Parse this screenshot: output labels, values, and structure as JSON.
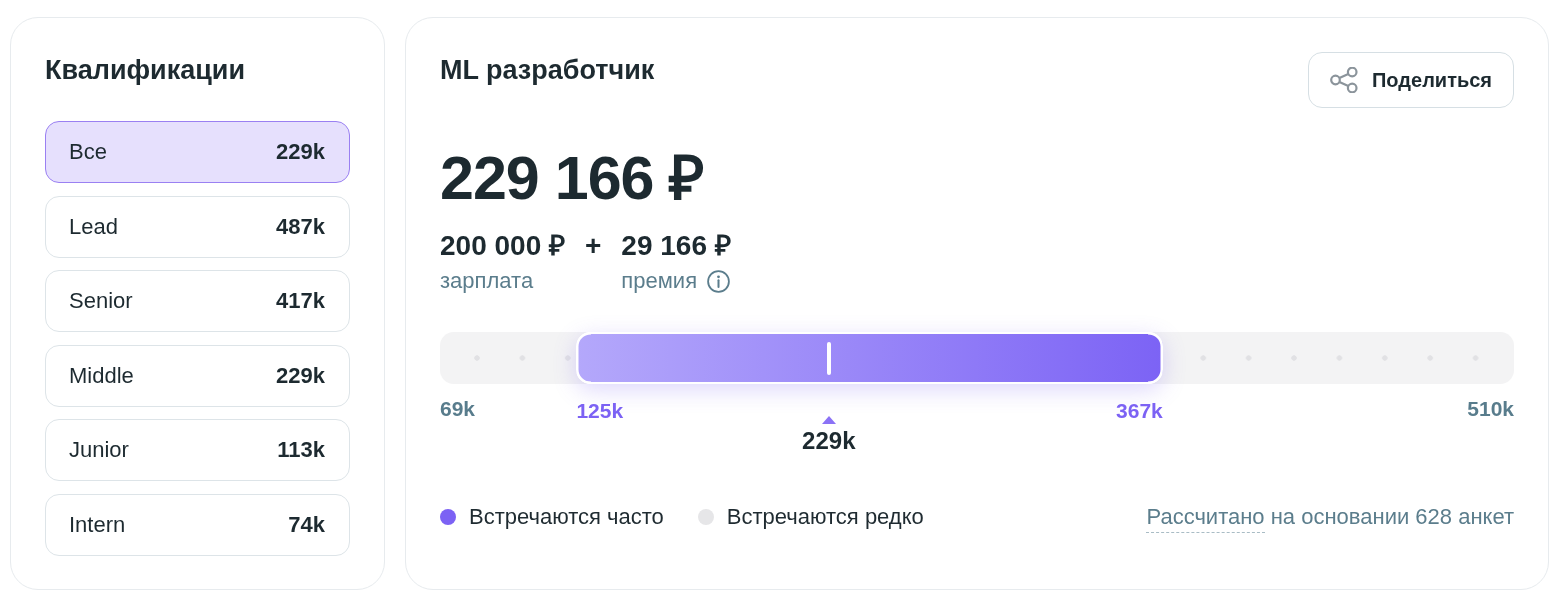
{
  "qualifications": {
    "title": "Квалификации",
    "items": [
      {
        "label": "Все",
        "value": "229k",
        "selected": true
      },
      {
        "label": "Lead",
        "value": "487k",
        "selected": false
      },
      {
        "label": "Senior",
        "value": "417k",
        "selected": false
      },
      {
        "label": "Middle",
        "value": "229k",
        "selected": false
      },
      {
        "label": "Junior",
        "value": "113k",
        "selected": false
      },
      {
        "label": "Intern",
        "value": "74k",
        "selected": false
      }
    ]
  },
  "salary": {
    "title": "ML разработчик",
    "share_button": "Поделиться",
    "total": "229 166 ₽",
    "base": {
      "amount": "200 000 ₽",
      "label": "зарплата"
    },
    "plus": "+",
    "bonus": {
      "amount": "29 166 ₽",
      "label": "премия"
    },
    "range": {
      "min": "69k",
      "max": "510k",
      "low": {
        "label": "125k",
        "level": 0.127
      },
      "high": {
        "label": "367k",
        "level": 0.673
      },
      "median": {
        "label": "229k",
        "level": 0.362
      }
    },
    "legend": [
      {
        "label": "Встречаются часто",
        "color": "#7c62f4"
      },
      {
        "label": "Встречаются редко",
        "color": "#e6e6e8"
      }
    ],
    "note": {
      "link": "Рассчитано",
      "text": "на основании 628 анкет"
    }
  }
}
